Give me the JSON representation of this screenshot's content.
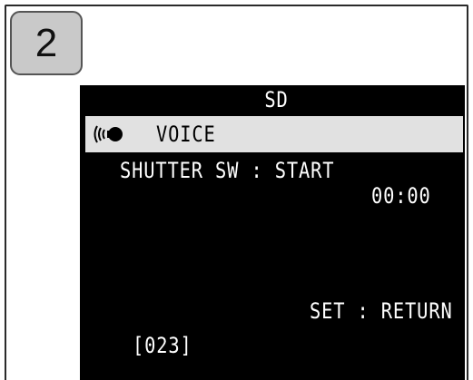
{
  "step": {
    "number": "2"
  },
  "screen": {
    "title": "SD",
    "mode": {
      "icon": "voice-recording-icon",
      "label": "VOICE"
    },
    "shutter_text": "SHUTTER SW : START",
    "timer": "00:00",
    "set_return": "SET : RETURN",
    "counter": "[023]"
  },
  "colors": {
    "screen_bg": "#000000",
    "screen_text": "#ffffff",
    "highlight_bar": "#e1e1e1",
    "badge_bg": "#c9c9c9"
  }
}
